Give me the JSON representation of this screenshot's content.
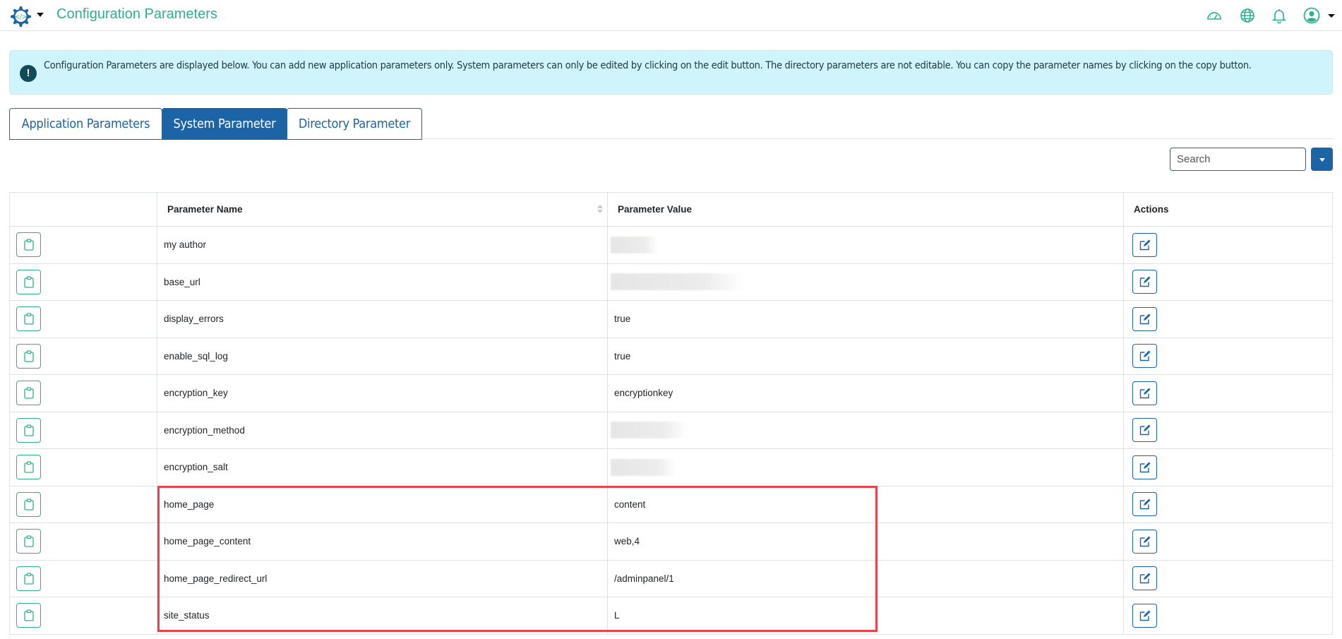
{
  "header": {
    "title": "Configuration Parameters",
    "icons": [
      "code-gear-logo-icon",
      "dashboard-gauge-icon",
      "globe-icon",
      "bell-icon",
      "user-avatar-icon"
    ]
  },
  "alert": {
    "icon": "exclamation-circle-icon",
    "text": "Configuration Parameters are displayed below. You can add new application parameters only. System parameters can only be edited by clicking on the edit button. The directory parameters are not editable. You can copy the parameter names by clicking on the copy button."
  },
  "tabs": [
    {
      "label": "Application Parameters",
      "active": false
    },
    {
      "label": "System Parameter",
      "active": true
    },
    {
      "label": "Directory Parameter",
      "active": false
    }
  ],
  "search": {
    "placeholder": "Search",
    "value": ""
  },
  "table": {
    "columns": [
      "",
      "Parameter Name",
      "Parameter Value",
      "Actions"
    ],
    "rows": [
      {
        "name": "my author",
        "value": "",
        "value_redacted": true
      },
      {
        "name": "base_url",
        "value": "",
        "value_redacted": true
      },
      {
        "name": "display_errors",
        "value": "true",
        "value_redacted": false
      },
      {
        "name": "enable_sql_log",
        "value": "true",
        "value_redacted": false
      },
      {
        "name": "encryption_key",
        "value": "encryptionkey",
        "value_redacted": false
      },
      {
        "name": "encryption_method",
        "value": "",
        "value_redacted": true
      },
      {
        "name": "encryption_salt",
        "value": "",
        "value_redacted": true
      },
      {
        "name": "home_page",
        "value": "content",
        "value_redacted": false,
        "highlighted": true
      },
      {
        "name": "home_page_content",
        "value": "web,4",
        "value_redacted": false,
        "highlighted": true
      },
      {
        "name": "home_page_redirect_url",
        "value": "/adminpanel/1",
        "value_redacted": false,
        "highlighted": true
      },
      {
        "name": "site_status",
        "value": "L",
        "value_redacted": false,
        "highlighted": true
      }
    ]
  },
  "colors": {
    "brand_green": "#2eb08c",
    "primary_blue": "#1c64a6",
    "alert_bg": "#cff4fc",
    "highlight_red": "#e8434a"
  }
}
